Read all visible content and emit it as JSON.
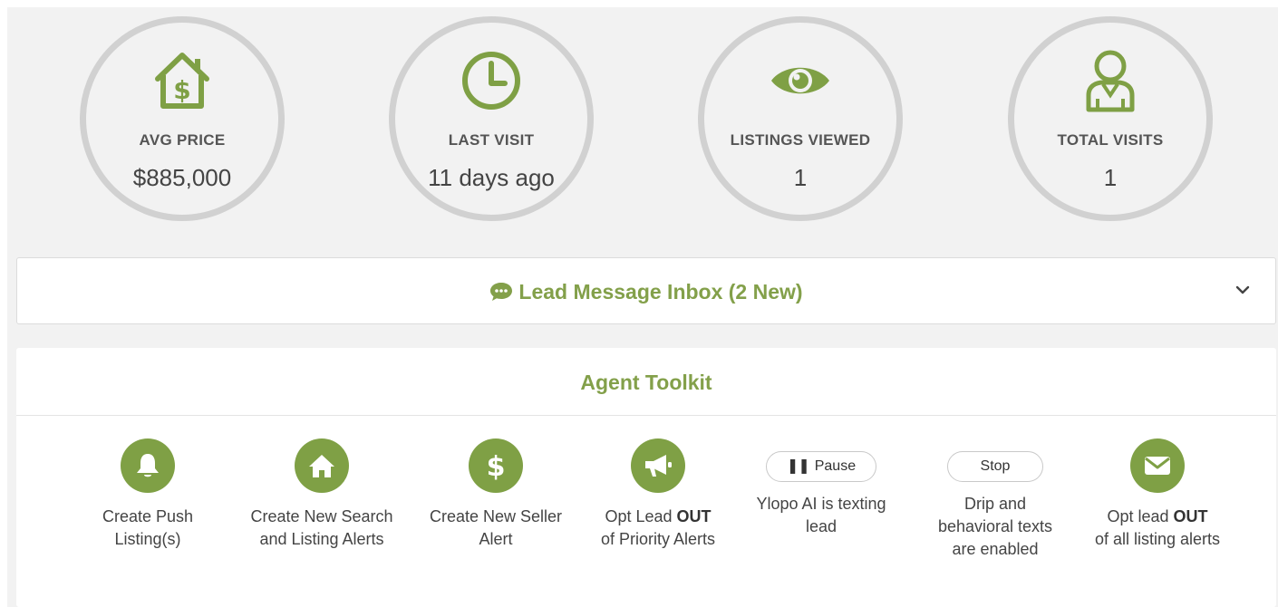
{
  "stats": [
    {
      "icon": "house-dollar-icon",
      "label": "AVG PRICE",
      "value": "$885,000"
    },
    {
      "icon": "clock-icon",
      "label": "LAST VISIT",
      "value": "11 days ago"
    },
    {
      "icon": "eye-icon",
      "label": "LISTINGS VIEWED",
      "value": "1"
    },
    {
      "icon": "user-icon",
      "label": "TOTAL VISITS",
      "value": "1"
    }
  ],
  "inbox": {
    "title": "Lead Message Inbox (2 New)",
    "icon": "chat-bubble-icon",
    "toggle_icon": "chevron-down-icon"
  },
  "toolkit": {
    "title": "Agent Toolkit",
    "tools": [
      {
        "icon": "bell-icon",
        "line1": "Create Push",
        "line2": "Listing(s)"
      },
      {
        "icon": "home-icon",
        "line1": "Create New Search",
        "line2": "and Listing Alerts"
      },
      {
        "icon": "dollar-icon",
        "line1": "Create New Seller",
        "line2": "Alert"
      },
      {
        "icon": "megaphone-icon",
        "pre1": "Opt Lead ",
        "bold1": "OUT",
        "line2": "of Priority Alerts"
      },
      {
        "button": "Pause",
        "button_icon": "pause-icon",
        "line1": "Ylopo AI is texting",
        "line2": "lead"
      },
      {
        "button": "Stop",
        "line1": "Drip and",
        "line2": "behavioral texts",
        "line3": "are enabled"
      },
      {
        "icon": "envelope-icon",
        "pre1": "Opt lead ",
        "bold1": "OUT",
        "line2": "of all listing alerts"
      }
    ]
  },
  "colors": {
    "accent": "#83a04a",
    "icon_bg": "#7fa045",
    "ring": "#d1d1d1",
    "background": "#f2f2f2"
  }
}
